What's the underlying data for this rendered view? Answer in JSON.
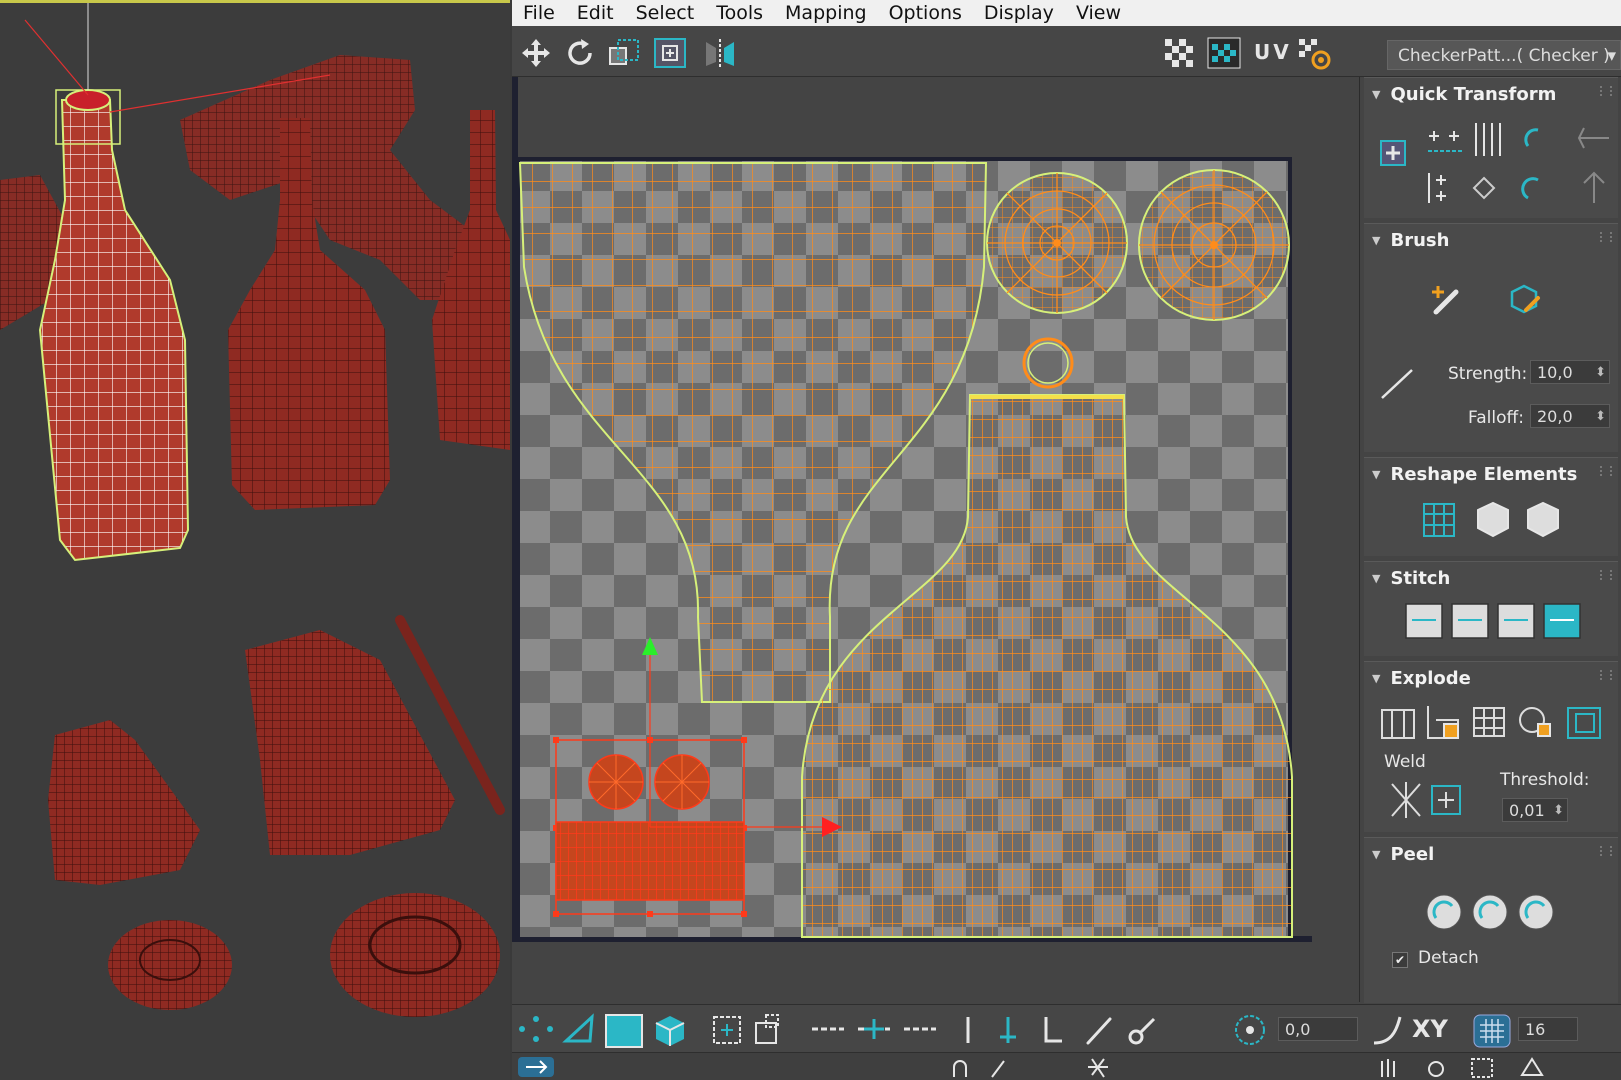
{
  "menu": [
    "File",
    "Edit",
    "Select",
    "Tools",
    "Mapping",
    "Options",
    "Display",
    "View"
  ],
  "toolbar": {
    "uv_label": "UV",
    "texture_dropdown": "CheckerPatt...( Checker )"
  },
  "panel": {
    "quick_transform": "Quick Transform",
    "brush": "Brush",
    "strength_label": "Strength:",
    "strength_value": "10,0",
    "falloff_label": "Falloff:",
    "falloff_value": "20,0",
    "reshape": "Reshape Elements",
    "stitch": "Stitch",
    "explode": "Explode",
    "weld_label": "Weld",
    "threshold_label": "Threshold:",
    "threshold_value": "0,01",
    "peel": "Peel",
    "detach_label": "Detach",
    "detach_checked": true
  },
  "bottombar": {
    "rotate_value": "0,0",
    "xy_label": "XY",
    "grid_value": "16"
  },
  "colors": {
    "uv_edge": "#ff8c1a",
    "uv_border": "#d6f07a",
    "selection": "#ff3a1a",
    "mesh_red": "#8f2a22",
    "accent_teal": "#2bb7c6"
  }
}
